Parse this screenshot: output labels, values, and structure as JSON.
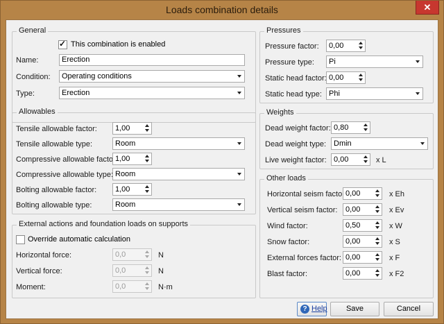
{
  "window": {
    "title": "Loads combination details",
    "close_glyph": "✕"
  },
  "general": {
    "title": "General",
    "enabled_label": "This combination is enabled",
    "enabled": true,
    "name_label": "Name:",
    "name_value": "Erection",
    "condition_label": "Condition:",
    "condition_value": "Operating conditions",
    "type_label": "Type:",
    "type_value": "Erection"
  },
  "allowables": {
    "title": "Allowables",
    "tensile_factor_label": "Tensile allowable factor:",
    "tensile_factor_value": "1,00",
    "tensile_type_label": "Tensile allowable type:",
    "tensile_type_value": "Room",
    "compressive_factor_label": "Compressive allowable factor:",
    "compressive_factor_value": "1,00",
    "compressive_type_label": "Compressive allowable type:",
    "compressive_type_value": "Room",
    "bolting_factor_label": "Bolting allowable factor:",
    "bolting_factor_value": "1,00",
    "bolting_type_label": "Bolting allowable type:",
    "bolting_type_value": "Room"
  },
  "external": {
    "title": "External actions and foundation loads on supports",
    "override_label": "Override automatic calculation",
    "override": false,
    "horizontal_label": "Horizontal force:",
    "horizontal_value": "0,0",
    "horizontal_unit": "N",
    "vertical_label": "Vertical force:",
    "vertical_value": "0,0",
    "vertical_unit": "N",
    "moment_label": "Moment:",
    "moment_value": "0,0",
    "moment_unit": "N·m"
  },
  "pressures": {
    "title": "Pressures",
    "pressure_factor_label": "Pressure factor:",
    "pressure_factor_value": "0,00",
    "pressure_type_label": "Pressure type:",
    "pressure_type_value": "Pi",
    "static_factor_label": "Static head factor:",
    "static_factor_value": "0,00",
    "static_type_label": "Static head type:",
    "static_type_value": "Phi"
  },
  "weights": {
    "title": "Weights",
    "dead_factor_label": "Dead weight factor:",
    "dead_factor_value": "0,80",
    "dead_type_label": "Dead weight type:",
    "dead_type_value": "Dmin",
    "live_factor_label": "Live weight factor:",
    "live_factor_value": "0,00",
    "live_suffix": "x L"
  },
  "other": {
    "title": "Other loads",
    "rows": [
      {
        "label": "Horizontal seism factor:",
        "value": "0,00",
        "suffix": "x Eh"
      },
      {
        "label": "Vertical seism factor:",
        "value": "0,00",
        "suffix": "x Ev"
      },
      {
        "label": "Wind factor:",
        "value": "0,50",
        "suffix": "x W"
      },
      {
        "label": "Snow factor:",
        "value": "0,00",
        "suffix": "x S"
      },
      {
        "label": "External forces factor:",
        "value": "0,00",
        "suffix": "x F"
      },
      {
        "label": "Blast factor:",
        "value": "0,00",
        "suffix": "x F2"
      }
    ]
  },
  "buttons": {
    "help": "Help",
    "help_icon_glyph": "?",
    "save": "Save",
    "cancel": "Cancel"
  }
}
